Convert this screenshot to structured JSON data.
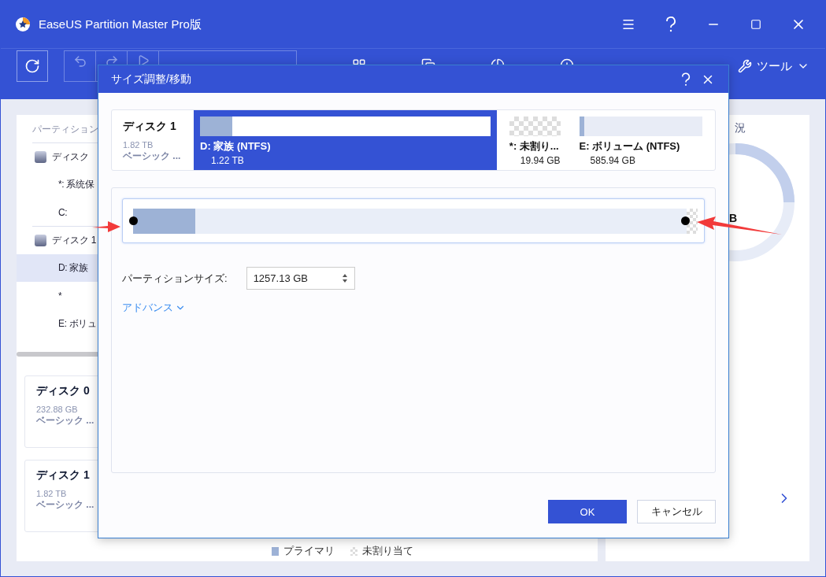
{
  "window": {
    "title": "EaseUS Partition Master Pro版"
  },
  "toolbar": {
    "tools_label": "ツール"
  },
  "sidebar": {
    "header": "パーティション",
    "items": [
      {
        "kind": "disk",
        "label": "ディスク",
        "selected": false
      },
      {
        "kind": "partition",
        "label": "*: 系统保",
        "selected": false
      },
      {
        "kind": "partition",
        "label": "C:",
        "selected": false
      },
      {
        "kind": "disk",
        "label": "ディスク 1",
        "selected": false
      },
      {
        "kind": "partition",
        "label": "D: 家族",
        "selected": true
      },
      {
        "kind": "partition",
        "label": "*",
        "selected": false
      },
      {
        "kind": "partition",
        "label": "E: ボリュ",
        "selected": false
      }
    ]
  },
  "disk_cards": [
    {
      "name": "ディスク 0",
      "size": "232.88 GB",
      "type": "ベーシック ..."
    },
    {
      "name": "ディスク 1",
      "size": "1.82 TB",
      "type": "ベーシック ..."
    }
  ],
  "legend": [
    {
      "kind": "primary",
      "label": "プライマリ"
    },
    {
      "kind": "unallocated",
      "label": "未割り当て"
    }
  ],
  "right_panel": {
    "title": "況",
    "donut_label": "B"
  },
  "dialog": {
    "title": "サイズ調整/移動",
    "disk": {
      "name": "ディスク 1",
      "size": "1.82 TB",
      "type": "ベーシック ..."
    },
    "partitions": [
      {
        "kind": "primary",
        "label": "D: 家族 (NTFS)",
        "size": "1.22 TB",
        "level": 0.11,
        "selected": true
      },
      {
        "kind": "unallocated",
        "label": "*: 未割り...",
        "size": "19.94 GB",
        "selected": false
      },
      {
        "kind": "primary",
        "label": "E: ボリューム (NTFS)",
        "size": "585.94 GB",
        "level": 0.04,
        "selected": false
      }
    ],
    "resize": {
      "level": 0.11
    },
    "size_label": "パーティションサイズ:",
    "size_value": "1257.13 GB",
    "advanced": "アドバンス",
    "buttons": {
      "ok": "OK",
      "cancel": "キャンセル"
    }
  }
}
